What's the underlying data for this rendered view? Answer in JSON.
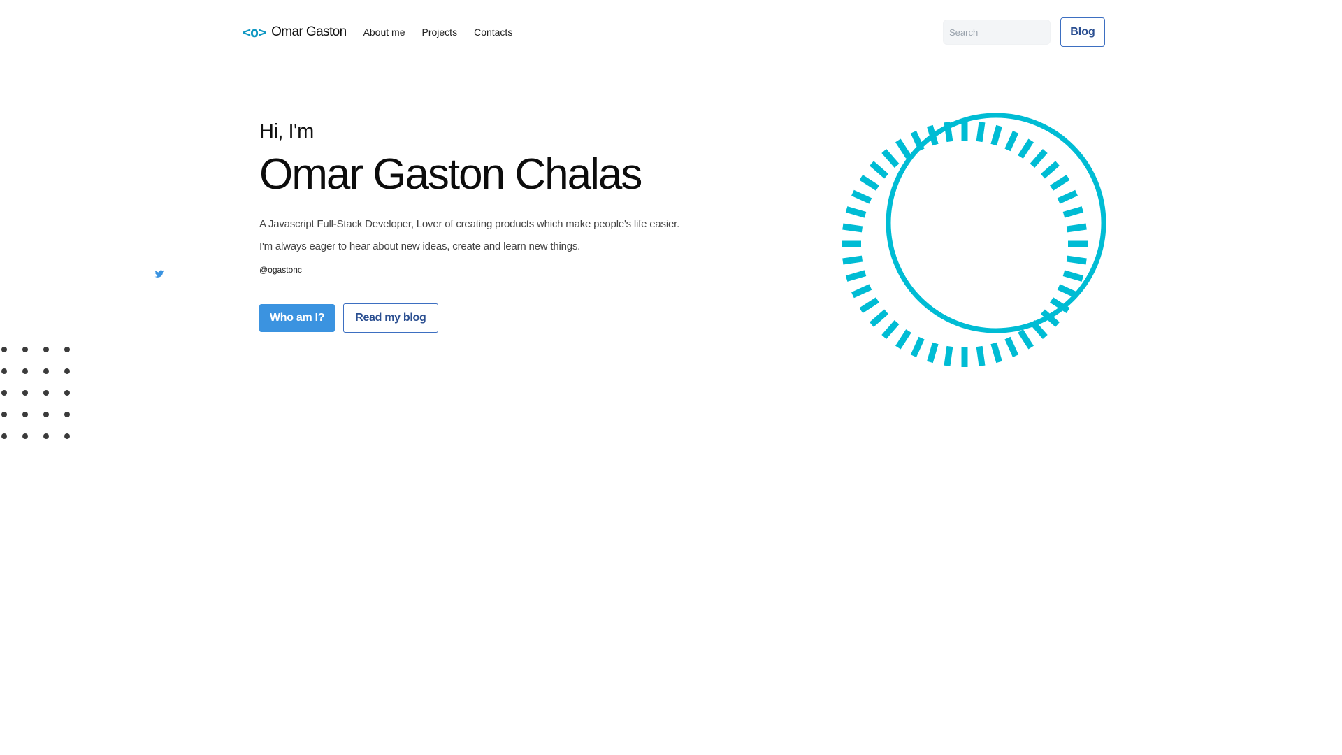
{
  "nav": {
    "brand_icon": "<o>",
    "brand_name": "Omar Gaston",
    "links": [
      {
        "label": "About me"
      },
      {
        "label": "Projects"
      },
      {
        "label": "Contacts"
      }
    ],
    "search_placeholder": "Search",
    "blog_label": "Blog"
  },
  "hero": {
    "greeting": "Hi, I'm",
    "name": "Omar Gaston Chalas",
    "description_line1": "A Javascript Full-Stack Developer, Lover of creating products which make people's life easier.",
    "description_line2": "I'm always eager to hear about new ideas, create and learn new things.",
    "handle": "@ogastonc",
    "primary_cta": "Who am I?",
    "secondary_cta": "Read my blog"
  },
  "social": {
    "twitter_icon": "twitter-icon"
  },
  "colors": {
    "accent": "#00bcd4",
    "primary_button": "#3b93e0",
    "outline_border": "#3d6fc1",
    "brand_icon": "#0e97c2",
    "twitter": "#3b93e0",
    "dots": "#3b3b3b"
  }
}
